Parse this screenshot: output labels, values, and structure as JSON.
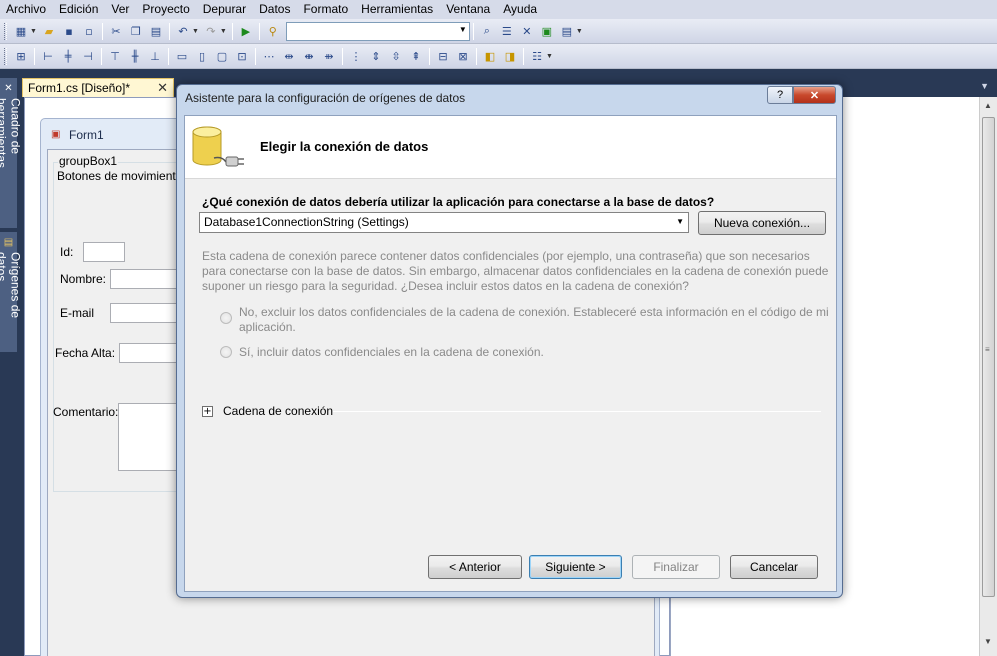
{
  "menu": [
    "Archivo",
    "Edición",
    "Ver",
    "Proyecto",
    "Depurar",
    "Datos",
    "Formato",
    "Herramientas",
    "Ventana",
    "Ayuda"
  ],
  "sidebar_tabs": [
    "Cuadro de herramientas",
    "Orígenes de datos"
  ],
  "doc_tab": {
    "label": "Form1.cs [Diseño]*",
    "close": "✕"
  },
  "form": {
    "title": "Form1",
    "groupbox": "groupBox1",
    "buttons_label": "Botones de movimiento:",
    "fields": {
      "id": "Id:",
      "nombre": "Nombre:",
      "email": "E-mail",
      "fecha_alta": "Fecha Alta:",
      "comentario": "Comentario:"
    }
  },
  "dialog": {
    "title": "Asistente para la configuración de orígenes de datos",
    "help": "?",
    "close": "✕",
    "header": "Elegir la conexión de datos",
    "question": "¿Qué conexión de datos debería utilizar la aplicación para conectarse a la base de datos?",
    "connection": "Database1ConnectionString (Settings)",
    "new_connection": "Nueva conexión...",
    "info": "Esta cadena de conexión parece contener datos confidenciales (por ejemplo, una contraseña) que son necesarios para conectarse con la base de datos. Sin embargo, almacenar datos confidenciales en la cadena de conexión puede suponer un riesgo para la seguridad. ¿Desea incluir estos datos en la cadena de conexión?",
    "option_no_line1": "No, excluir los datos confidenciales de la cadena de conexión. Estableceré esta información en el código de mi",
    "option_no_line2": "aplicación.",
    "option_yes": "Sí, incluir datos confidenciales en la cadena de conexión.",
    "expander": "+",
    "conn_string_label": "Cadena de conexión",
    "buttons": {
      "back": "< Anterior",
      "next": "Siguiente >",
      "finish": "Finalizar",
      "cancel": "Cancelar"
    }
  }
}
